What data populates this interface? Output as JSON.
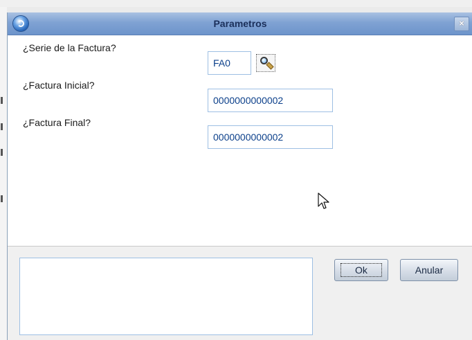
{
  "dialog": {
    "title": "Parametros",
    "close_symbol": "×"
  },
  "params": [
    {
      "label": "¿Serie de la Factura?",
      "value": "FA0"
    },
    {
      "label": "¿Factura Inicial?",
      "value": "0000000000002"
    },
    {
      "label": "¿Factura Final?",
      "value": "0000000000002"
    }
  ],
  "buttons": {
    "ok_label": "Ok",
    "cancel_label": "Anular"
  },
  "icons": {
    "title_logo": "app-logo-icon",
    "lookup": "magnifier-icon",
    "cursor": "mouse-pointer-icon"
  },
  "colors": {
    "titlebar": "#7fa2d3",
    "field_border": "#9dbfe3",
    "field_text": "#0b3f8a"
  },
  "message_area": {
    "text": ""
  }
}
